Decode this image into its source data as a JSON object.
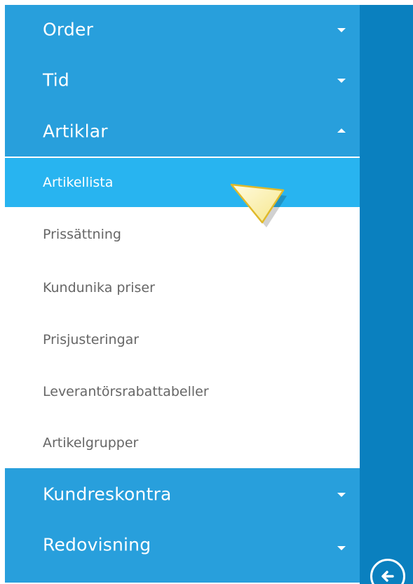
{
  "menu": {
    "sections_top": [
      {
        "label": "Order",
        "caret": "chevron-down-icon"
      },
      {
        "label": "Tid",
        "caret": "chevron-down-icon"
      },
      {
        "label": "Artiklar",
        "caret": "chevron-up-icon"
      }
    ],
    "subitems": [
      {
        "label": "Artikellista",
        "active": true
      },
      {
        "label": "Prissättning",
        "active": false
      },
      {
        "label": "Kundunika priser",
        "active": false
      },
      {
        "label": "Prisjusteringar",
        "active": false
      },
      {
        "label": "Leverantörsrabattabeller",
        "active": false
      },
      {
        "label": "Artikelgrupper",
        "active": false
      }
    ],
    "sections_bottom": [
      {
        "label": "Kundreskontra",
        "caret": "chevron-down-icon"
      },
      {
        "label": "Redovisning",
        "caret": "chevron-down-icon"
      }
    ]
  },
  "colors": {
    "section_bg": "#289fdc",
    "active_item_bg": "#28b4f0",
    "rail_bg": "#0a80bf",
    "subitem_text": "#666666",
    "pointer_fill": "#fff9c8"
  },
  "rail": {
    "back_icon": "arrow-left-circle-icon"
  }
}
